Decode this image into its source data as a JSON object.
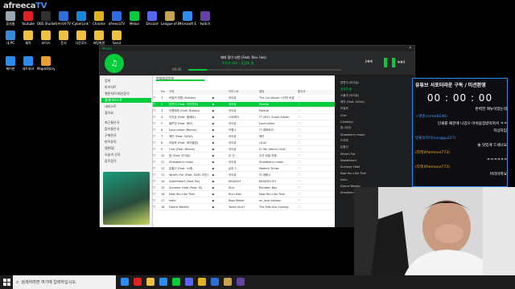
{
  "watermark": {
    "prefix": "afreeca",
    "suffix": "TV"
  },
  "desktop_icons": [
    {
      "label": "휴지통",
      "color": "#9aa6b2"
    },
    {
      "label": "Youtube",
      "color": "#e02020"
    },
    {
      "label": "OBS Studio",
      "color": "#303030"
    },
    {
      "label": "아프리카TV 티비",
      "color": "#2a70d8"
    },
    {
      "label": "CyberLink YouCam 9",
      "color": "#1b87d6"
    },
    {
      "label": "Chrome",
      "color": "#e2b21c"
    },
    {
      "label": "afreecaTV",
      "color": "#2e6ee0"
    },
    {
      "label": "Melon",
      "color": "#00cd3c"
    },
    {
      "label": "Discord",
      "color": "#5865f2"
    },
    {
      "label": "League of Legends",
      "color": "#c8a050"
    },
    {
      "label": "Microsoft Edge",
      "color": "#2d8cf0"
    },
    {
      "label": "twitch",
      "color": "#6441a5"
    },
    {
      "label": "내 PC",
      "color": "#3a8ad8"
    },
    {
      "label": "제목",
      "color": "#f0c040"
    },
    {
      "label": "보이스",
      "color": "#f0c040"
    },
    {
      "label": "문서",
      "color": "#f0c040"
    },
    {
      "label": "다운로드",
      "color": "#f0c040"
    },
    {
      "label": "바탕화면",
      "color": "#f0c040"
    },
    {
      "label": "Send",
      "color": "#f0c040"
    },
    {
      "label": "제어판",
      "color": "#2d8cf0"
    },
    {
      "label": "네트워크",
      "color": "#2d8cf0"
    },
    {
      "label": "MapleStory",
      "color": "#e8a030"
    }
  ],
  "melon": {
    "title": "Melon",
    "now_playing": "때따 맘이 되면 (Feat. Rev. hes)",
    "now_playing_sub": "아이유 (IU) - 꽃갈피 둘",
    "time": "00:00",
    "sidebar": {
      "items": [
        "검색",
        "마이차트",
        "멜론차트/최신음악",
        "플레이리스트",
        "내리스트",
        "좋아요",
        "최근들은곡",
        "많이들은곡",
        "구매한곡",
        "마이뮤직",
        "멜론DJ",
        "오늘의 선곡",
        "장르음악"
      ],
      "selected_index": 3
    },
    "tab": "현재재생목록",
    "columns": [
      "",
      "No",
      "곡명",
      "",
      "아티스트",
      "앨범",
      "좋아요"
    ],
    "rows": [
      {
        "no": "1",
        "title": "비밀의 정원 (Hidden)",
        "artist": "아이유",
        "album": "The 1st Album 시간의 바깥",
        "likes": ""
      },
      {
        "no": "2",
        "title": "밤편지 (Feat. 자이언티)",
        "artist": "아이유",
        "album": "Palette",
        "likes": ""
      },
      {
        "no": "3",
        "title": "이름에게 (Feat. Brooks)",
        "artist": "아이유",
        "album": "Palette",
        "likes": ""
      },
      {
        "no": "4",
        "title": "이지금 (Feat. 팔레트)",
        "artist": "스트레이",
        "album": "?? 2021 Guest Album",
        "likes": ""
      },
      {
        "no": "5",
        "title": "블루밍 (Feat. 혁오)",
        "artist": "아이유",
        "album": "Love poem",
        "likes": ""
      },
      {
        "no": "6",
        "title": "Love poem (Remix)",
        "artist": "이병스",
        "album": "?? 레퍼토리",
        "likes": ""
      },
      {
        "no": "7",
        "title": "에잇 (Feat. SUGA)",
        "artist": "아이유",
        "album": "에잇",
        "likes": ""
      },
      {
        "no": "8",
        "title": "라일락 (Feat. 세이클럽)",
        "artist": "아이유",
        "album": "LILAC",
        "likes": ""
      },
      {
        "no": "9",
        "title": "Coin (Feat. Remix)",
        "artist": "아이유",
        "album": "IU 5th Album LILAC",
        "likes": ""
      },
      {
        "no": "10",
        "title": "잠 (Feat. 아이유)",
        "artist": "우 선",
        "album": "우선 비밀 여행",
        "likes": ""
      },
      {
        "no": "11",
        "title": "Strawberry moon",
        "artist": "아이유",
        "album": "Strawberry moon",
        "likes": ""
      },
      {
        "no": "12",
        "title": "분홍신 (Feat. 노래)",
        "artist": "손마 2",
        "album": "Modern Times",
        "likes": ""
      },
      {
        "no": "13",
        "title": "What's For (Feat. DVM. 리안)",
        "artist": "아이유",
        "album": "이 대행시",
        "likes": ""
      },
      {
        "no": "14",
        "title": "Sweetheart (Feat. Bo)",
        "artist": "KKADOH",
        "album": "KKADOH EO",
        "likes": ""
      },
      {
        "no": "15",
        "title": "Summer Hate (Feat. 비)",
        "artist": "Zico",
        "album": "Random Box",
        "likes": ""
      },
      {
        "no": "16",
        "title": "Now You Like That",
        "artist": "Rich Kidz",
        "album": "Now You Like That",
        "likes": ""
      },
      {
        "no": "17",
        "title": "hello",
        "artist": "Ross Maker",
        "album": "on_love session",
        "likes": ""
      },
      {
        "no": "18",
        "title": "Dance Weekly",
        "artist": "Tones And I",
        "album": "The Kids Are Coming",
        "likes": ""
      }
    ],
    "playlist_panel": [
      "밤편지 (아이유)",
      "꽃갈피 둘",
      "스물셋 (아이유)",
      "에잇 (Feat. SUGA)",
      "라일락",
      "Coin",
      "Celebrity",
      "잠 (우선)",
      "Strawberry moon",
      "드라마",
      "분홍신",
      "What's For",
      "Sweetheart",
      "Summer Hate",
      "Now You Like That",
      "hello",
      "Dance Weekly",
      "Strawberry moon"
    ]
  },
  "overlay": {
    "heading": "유튜브 서포터라운 구독 / 미션환영",
    "timer": "00 : 00 : 00",
    "lines": [
      {
        "text": "완벽한 매뉴이었는데",
        "color": "#ffffff"
      },
      {
        "text": "ㅅ명준(rome8240)",
        "color": "#3a9cff"
      },
      {
        "text": "인쇄를 때문에 나갔으 아쉬움집방막혀서 ㅋㅋ",
        "color": "#ffffff"
      },
      {
        "text": "지상자임",
        "color": "#ffffff"
      },
      {
        "text": "방풀의하이(sunggu227)",
        "color": "#3a9cff"
      },
      {
        "text": "술 맛있게 드세나요",
        "color": "#ffffff"
      },
      {
        "text": "(라레)themove773)",
        "color": "#f0b030"
      },
      {
        "text": "ㅋㅋㅋㅋㅋㅋ",
        "color": "#ffffff"
      },
      {
        "text": "(라레)themove773)",
        "color": "#f0b030"
      },
      {
        "text": "머리아파요",
        "color": "#ffffff"
      }
    ]
  },
  "taskbar": {
    "search_placeholder": "검색하려면 여기에 입력하십시오.",
    "apps": [
      "#2d8cf0",
      "#e02020",
      "#f0c040",
      "#2d8cf0",
      "#00cd3c",
      "#5865f2",
      "#e2b21c",
      "#2a70d8",
      "#c8a050",
      "#6441a5"
    ],
    "time": "오후"
  }
}
